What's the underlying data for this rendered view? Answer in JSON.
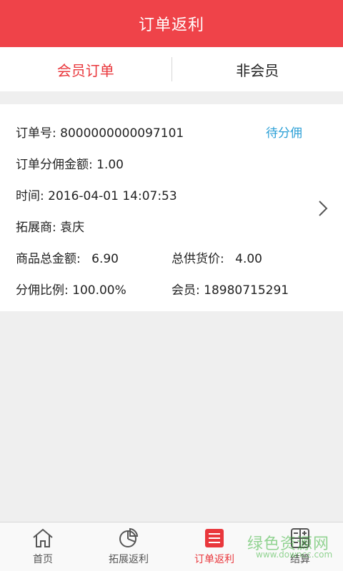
{
  "header": {
    "title": "订单返利"
  },
  "tabs": [
    {
      "label": "会员订单",
      "active": true
    },
    {
      "label": "非会员",
      "active": false
    }
  ],
  "order": {
    "order_no_label": "订单号:",
    "order_no": "8000000000097101",
    "status": "待分佣",
    "commission_amount_label": "订单分佣金额:",
    "commission_amount": "1.00",
    "time_label": "时间:",
    "time": "2016-04-01 14:07:53",
    "promoter_label": "拓展商:",
    "promoter": "袁庆",
    "goods_total_label": "商品总金额:",
    "goods_total": "6.90",
    "supply_total_label": "总供货价:",
    "supply_total": "4.00",
    "ratio_label": "分佣比例:",
    "ratio": "100.00%",
    "member_label": "会员:",
    "member": "18980715291"
  },
  "bottom_nav": [
    {
      "label": "首页",
      "icon": "home-icon"
    },
    {
      "label": "拓展返利",
      "icon": "pie-chart-icon"
    },
    {
      "label": "订单返利",
      "icon": "list-icon",
      "active": true
    },
    {
      "label": "结算",
      "icon": "calculator-icon"
    }
  ],
  "watermark": {
    "text": "绿色资源网",
    "sub": "www.downcc.com"
  },
  "colors": {
    "accent": "#ef4349",
    "status_blue": "#2a9fd6"
  }
}
